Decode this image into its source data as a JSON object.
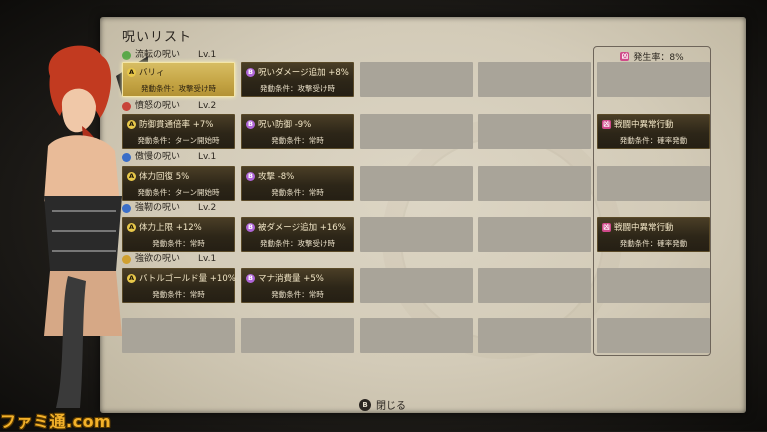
{
  "screen": {
    "title": "呪いリスト",
    "close_hint": "閉じる",
    "close_button_glyph": "B"
  },
  "rows": [
    {
      "name": "流転の呪い",
      "level": "Lv.1",
      "gem_color": "#5aa84a"
    },
    {
      "name": "憤怒の呪い",
      "level": "Lv.2",
      "gem_color": "#c8443a"
    },
    {
      "name": "傲慢の呪い",
      "level": "Lv.1",
      "gem_color": "#3a6ec8"
    },
    {
      "name": "強靭の呪い",
      "level": "Lv.2",
      "gem_color": "#3a6ec8"
    },
    {
      "name": "強欲の呪い",
      "level": "Lv.1",
      "gem_color": "#d0a030"
    }
  ],
  "slots": [
    [
      {
        "badge": "A",
        "name": "バリィ",
        "condition": "発動条件：攻撃受け時",
        "selected": true
      },
      {
        "badge": "B",
        "name": "呪いダメージ追加 +8%",
        "condition": "発動条件：攻撃受け時"
      },
      null,
      null
    ],
    [
      {
        "badge": "A",
        "name": "防御貫通倍率 +7%",
        "condition": "発動条件：ターン開始時"
      },
      {
        "badge": "B",
        "name": "呪い防御 -9%",
        "condition": "発動条件：常時"
      },
      null,
      null
    ],
    [
      {
        "badge": "A",
        "name": "体力回復 5%",
        "condition": "発動条件：ターン開始時"
      },
      {
        "badge": "B",
        "name": "攻撃 -8%",
        "condition": "発動条件：常時"
      },
      null,
      null
    ],
    [
      {
        "badge": "A",
        "name": "体力上限 +12%",
        "condition": "発動条件：常時"
      },
      {
        "badge": "B",
        "name": "被ダメージ追加 +16%",
        "condition": "発動条件：攻撃受け時"
      },
      null,
      null
    ],
    [
      {
        "badge": "A",
        "name": "バトルゴールド量 +10%",
        "condition": "発動条件：常時"
      },
      {
        "badge": "B",
        "name": "マナ消費量 +5%",
        "condition": "発動条件：常時"
      },
      null,
      null
    ],
    [
      null,
      null,
      null,
      null
    ]
  ],
  "side_panel": {
    "header": "発生率：8%",
    "slots": [
      null,
      {
        "badge": "凶",
        "name": "戦闘中異常行動",
        "condition": "発動条件：確率発動"
      },
      null,
      {
        "badge": "凶",
        "name": "戦闘中異常行動",
        "condition": "発動条件：確率発動"
      },
      null,
      null
    ]
  },
  "watermark": "ファミ通.com"
}
